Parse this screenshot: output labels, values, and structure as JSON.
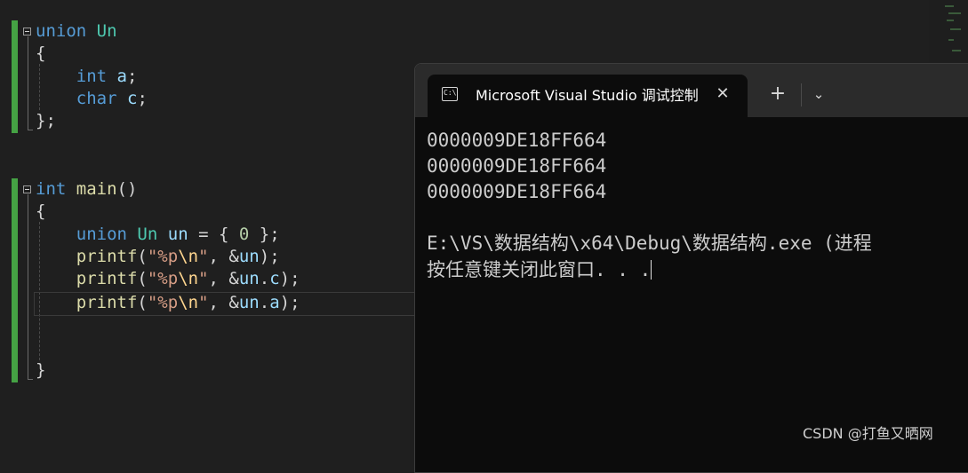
{
  "editor": {
    "union_block": {
      "kw_union": "union",
      "type_name": "Un",
      "open_brace": "{",
      "member_int_kw": "int",
      "member_int_name": "a",
      "semi": ";",
      "member_char_kw": "char",
      "member_char_name": "c",
      "close_brace": "};"
    },
    "main_block": {
      "ret_kw": "int",
      "fn_name": "main",
      "parens": "()",
      "open_brace": "{",
      "decl_kw": "union",
      "decl_type": "Un",
      "decl_var": "un",
      "decl_eq": " = { ",
      "decl_zero": "0",
      "decl_end": " };",
      "printf": "printf",
      "lparen": "(",
      "str_open": "\"%p",
      "str_esc": "\\n",
      "str_close": "\"",
      "comma_amp": ", &",
      "arg_un": "un",
      "dot": ".",
      "member_c": "c",
      "member_a": "a",
      "rparen_semi": ");",
      "close_brace": "}"
    },
    "colors": {
      "keyword": "#569cd6",
      "type": "#4ec9b0",
      "variable": "#9cdcfe",
      "function": "#dcdcaa",
      "string": "#d69d85",
      "escape": "#ffd68f",
      "number": "#b5cea8",
      "change_bar": "#45a244"
    }
  },
  "terminal": {
    "tab_icon": "console-icon",
    "tab_icon_glyph": "C:\\",
    "tab_title": "Microsoft Visual Studio 调试控制台",
    "close_glyph": "✕",
    "new_tab_glyph": "+",
    "dropdown_glyph": "⌄",
    "output": [
      "0000009DE18FF664",
      "0000009DE18FF664",
      "0000009DE18FF664"
    ],
    "exit_message": "E:\\VS\\数据结构\\x64\\Debug\\数据结构.exe (进程",
    "prompt": "按任意键关闭此窗口. . ."
  },
  "watermark": "CSDN @打鱼又晒网"
}
